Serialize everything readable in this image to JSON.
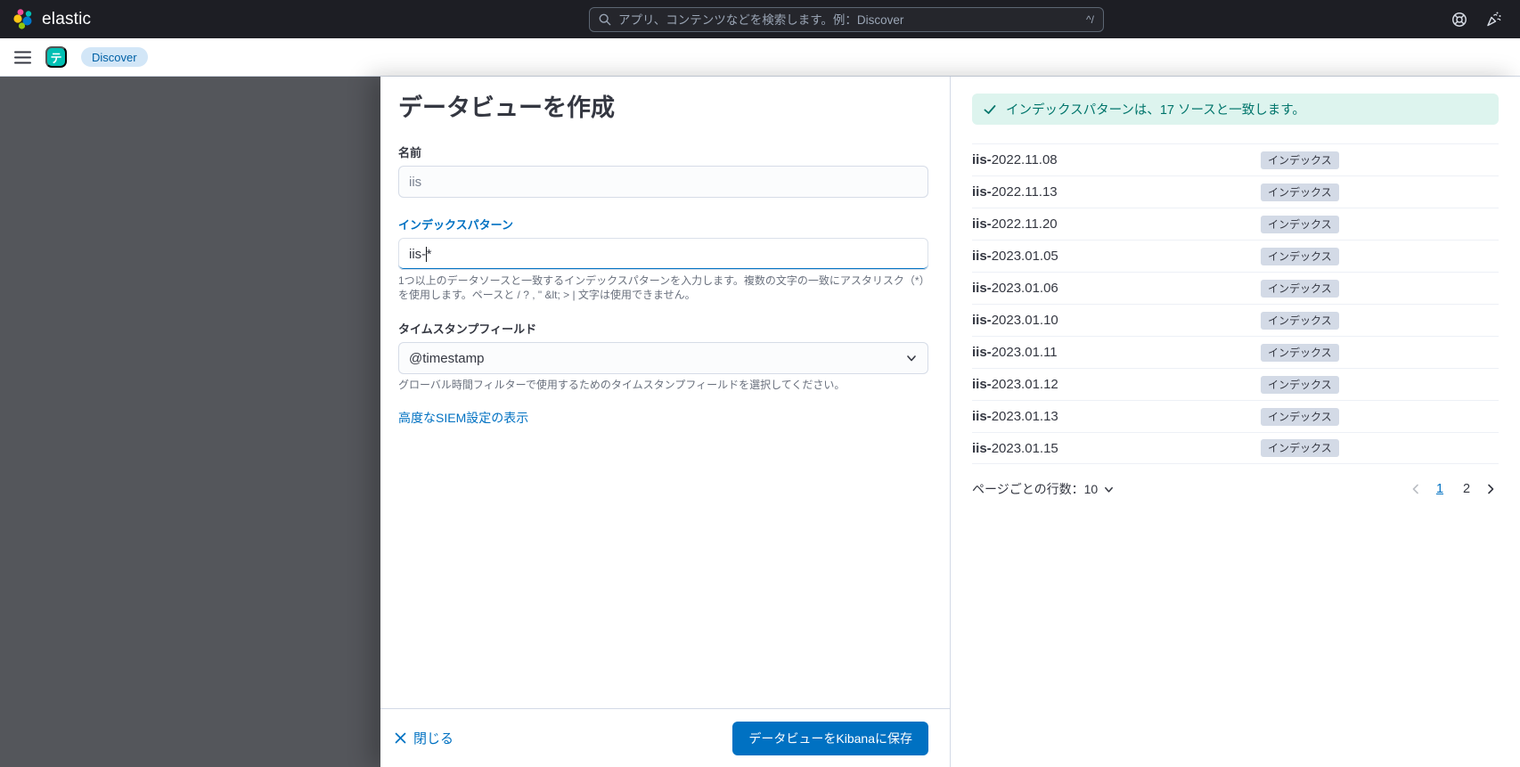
{
  "header": {
    "logo_text": "elastic",
    "search": {
      "placeholder": "アプリ、コンテンツなどを検索します。例：Discover",
      "shortcut_hint": "^/"
    }
  },
  "breadcrumb_bar": {
    "space_badge": "テ",
    "breadcrumb": "Discover"
  },
  "flyout": {
    "title": "データビューを作成",
    "name_field": {
      "label": "名前",
      "placeholder": "iis"
    },
    "index_pattern_field": {
      "label": "インデックスパターン",
      "value": "iis-*",
      "value_before_caret": "iis-",
      "value_after_caret": "*",
      "help": "1つ以上のデータソースと一致するインデックスパターンを入力します。複数の文字の一致にアスタリスク（*）を使用します。ペースと / ? , \" &lt; > | 文字は使用できません。"
    },
    "timestamp_field": {
      "label": "タイムスタンプフィールド",
      "value": "@timestamp",
      "help": "グローバル時間フィルターで使用するためのタイムスタンプフィールドを選択してください。"
    },
    "advanced_link": "高度なSIEM設定の表示",
    "footer": {
      "close_label": "閉じる",
      "save_label": "データビューをKibanaに保存"
    }
  },
  "preview": {
    "callout_message": "インデックスパターンは、17 ソースと一致します。",
    "rows": [
      {
        "prefix": "iis-",
        "rest": "2022.11.08",
        "badge": "インデックス"
      },
      {
        "prefix": "iis-",
        "rest": "2022.11.13",
        "badge": "インデックス"
      },
      {
        "prefix": "iis-",
        "rest": "2022.11.20",
        "badge": "インデックス"
      },
      {
        "prefix": "iis-",
        "rest": "2023.01.05",
        "badge": "インデックス"
      },
      {
        "prefix": "iis-",
        "rest": "2023.01.06",
        "badge": "インデックス"
      },
      {
        "prefix": "iis-",
        "rest": "2023.01.10",
        "badge": "インデックス"
      },
      {
        "prefix": "iis-",
        "rest": "2023.01.11",
        "badge": "インデックス"
      },
      {
        "prefix": "iis-",
        "rest": "2023.01.12",
        "badge": "インデックス"
      },
      {
        "prefix": "iis-",
        "rest": "2023.01.13",
        "badge": "インデックス"
      },
      {
        "prefix": "iis-",
        "rest": "2023.01.15",
        "badge": "インデックス"
      }
    ],
    "pagination": {
      "rows_per_page_label": "ページごとの行数：10",
      "page1": "1",
      "page2": "2",
      "active_page": "1"
    }
  },
  "icons": {
    "search": "magnifier",
    "help": "life-ring",
    "newsfeed": "party-popper",
    "menu": "hamburger",
    "close": "x-cross",
    "success": "checkmark",
    "select": "chevron-down",
    "prev": "chevron-left",
    "next": "chevron-right"
  },
  "colors": {
    "header_bg": "#1d1e24",
    "primary": "#0071c2",
    "space_teal": "#00bfb3",
    "success_bg": "#ddf4ee",
    "success_text": "#00756b",
    "badge_bg": "#d3dae6",
    "overlay": "#54565b"
  }
}
